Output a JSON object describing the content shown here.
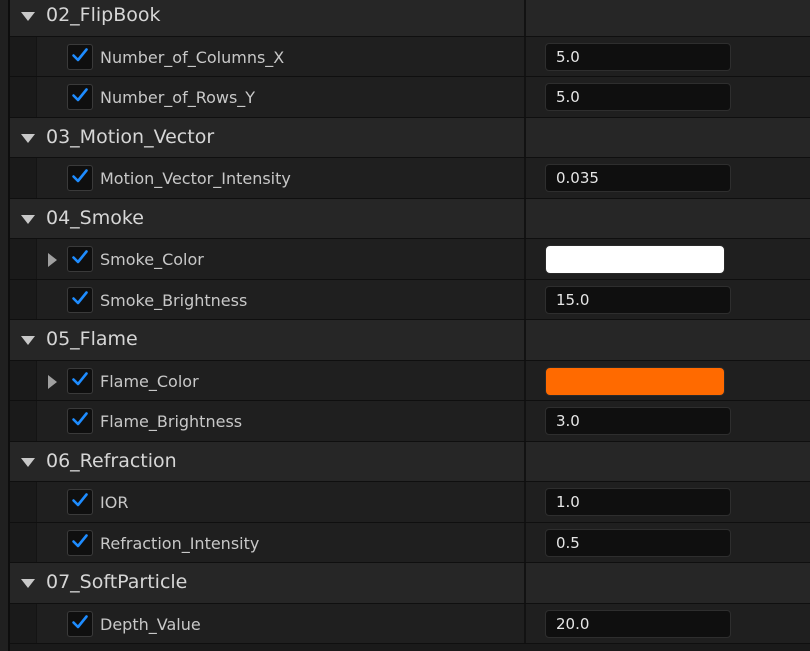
{
  "colors": {
    "checkmark": "#1e8cff",
    "smoke_color": "#ffffff",
    "flame_color": "#ff6a00"
  },
  "categories": [
    {
      "label": "02_FlipBook",
      "params": [
        {
          "label": "Number_of_Columns_X",
          "type": "number",
          "value": "5.0",
          "checked": true
        },
        {
          "label": "Number_of_Rows_Y",
          "type": "number",
          "value": "5.0",
          "checked": true
        }
      ]
    },
    {
      "label": "03_Motion_Vector",
      "params": [
        {
          "label": "Motion_Vector_Intensity",
          "type": "number",
          "value": "0.035",
          "checked": true
        }
      ]
    },
    {
      "label": "04_Smoke",
      "params": [
        {
          "label": "Smoke_Color",
          "type": "color",
          "color": "#ffffff",
          "checked": true,
          "expandable": true
        },
        {
          "label": "Smoke_Brightness",
          "type": "number",
          "value": "15.0",
          "checked": true
        }
      ]
    },
    {
      "label": "05_Flame",
      "params": [
        {
          "label": "Flame_Color",
          "type": "color",
          "color": "#ff6a00",
          "checked": true,
          "expandable": true
        },
        {
          "label": "Flame_Brightness",
          "type": "number",
          "value": "3.0",
          "checked": true
        }
      ]
    },
    {
      "label": "06_Refraction",
      "params": [
        {
          "label": "IOR",
          "type": "number",
          "value": "1.0",
          "checked": true
        },
        {
          "label": "Refraction_Intensity",
          "type": "number",
          "value": "0.5",
          "checked": true
        }
      ]
    },
    {
      "label": "07_SoftParticle",
      "params": [
        {
          "label": "Depth_Value",
          "type": "number",
          "value": "20.0",
          "checked": true
        }
      ]
    }
  ]
}
